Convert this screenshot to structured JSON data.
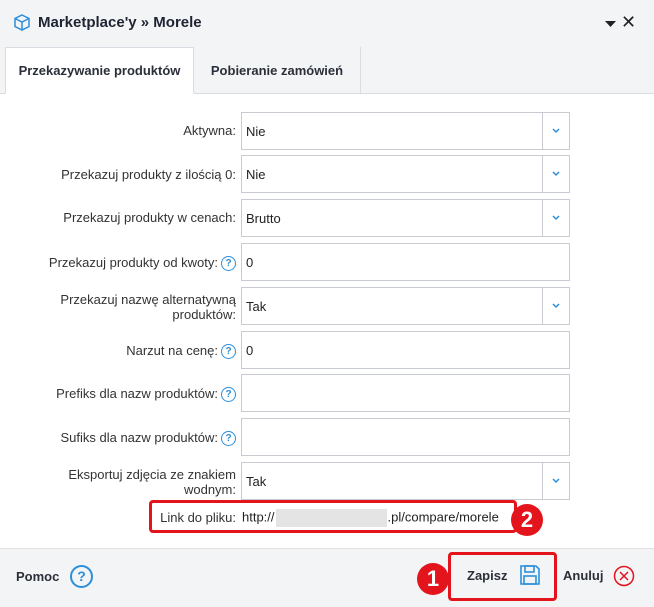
{
  "window": {
    "title": "Marketplace'y » Morele"
  },
  "tabs": [
    {
      "label": "Przekazywanie produktów",
      "active": true
    },
    {
      "label": "Pobieranie zamówień",
      "active": false
    }
  ],
  "form": {
    "aktywna": {
      "label": "Aktywna:",
      "value": "Nie"
    },
    "ilosc_zero": {
      "label": "Przekazuj produkty z ilością 0:",
      "value": "Nie"
    },
    "w_cenach": {
      "label": "Przekazuj produkty w cenach:",
      "value": "Brutto"
    },
    "od_kwoty": {
      "label": "Przekazuj produkty od kwoty:",
      "value": "0"
    },
    "nazwa_alt": {
      "label_line1": "Przekazuj nazwę alternatywną",
      "label_line2": "produktów:",
      "value": "Tak"
    },
    "narzut": {
      "label": "Narzut na cenę:",
      "value": "0"
    },
    "prefiks": {
      "label": "Prefiks dla nazw produktów:",
      "value": ""
    },
    "sufiks": {
      "label": "Sufiks dla nazw produktów:",
      "value": ""
    },
    "zdjecia": {
      "label_line1": "Eksportuj zdjęcia ze znakiem",
      "label_line2": "wodnym:",
      "value": "Tak"
    },
    "link": {
      "label": "Link do pliku:",
      "prefix": "http://",
      "suffix": ".pl/compare/morele"
    }
  },
  "annotations": {
    "one": "1",
    "two": "2"
  },
  "footer": {
    "help_label": "Pomoc",
    "help_icon_glyph": "?",
    "save_label": "Zapisz",
    "cancel_label": "Anuluj"
  },
  "colors": {
    "accent": "#2c8fd9",
    "highlight": "#e3141b"
  }
}
